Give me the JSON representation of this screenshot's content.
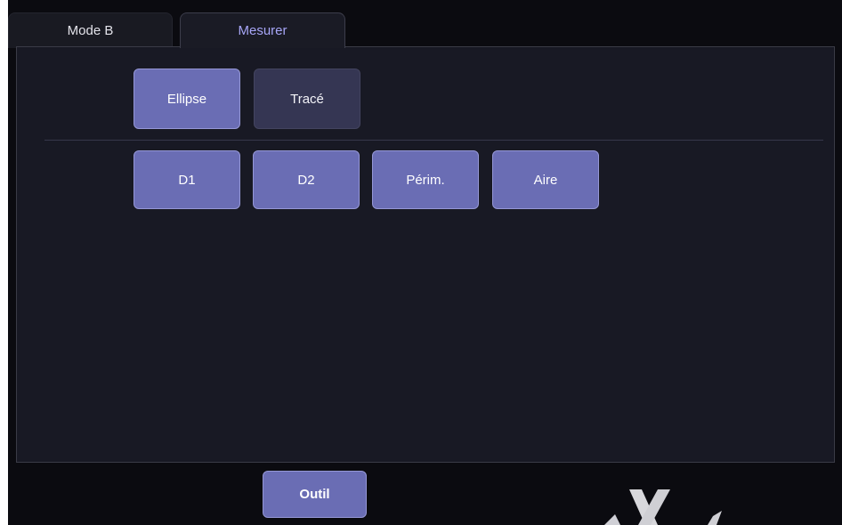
{
  "tabs": [
    {
      "label": "Mode B",
      "active": false
    },
    {
      "label": "Mesurer",
      "active": true
    }
  ],
  "tool_types": [
    {
      "label": "Ellipse",
      "selected": true
    },
    {
      "label": "Tracé",
      "selected": false
    }
  ],
  "measurements": [
    {
      "label": "D1"
    },
    {
      "label": "D2"
    },
    {
      "label": "Périm."
    },
    {
      "label": "Aire"
    }
  ],
  "footer": {
    "tool_button_label": "Outil"
  },
  "colors": {
    "accent": "#6a6db4",
    "accent_dim": "#353653",
    "tab_active_text": "#a7a6f7",
    "panel_bg": "#181924",
    "screen_bg": "#0b0b10"
  },
  "icons": {
    "watermark": "brand-x-logo"
  }
}
